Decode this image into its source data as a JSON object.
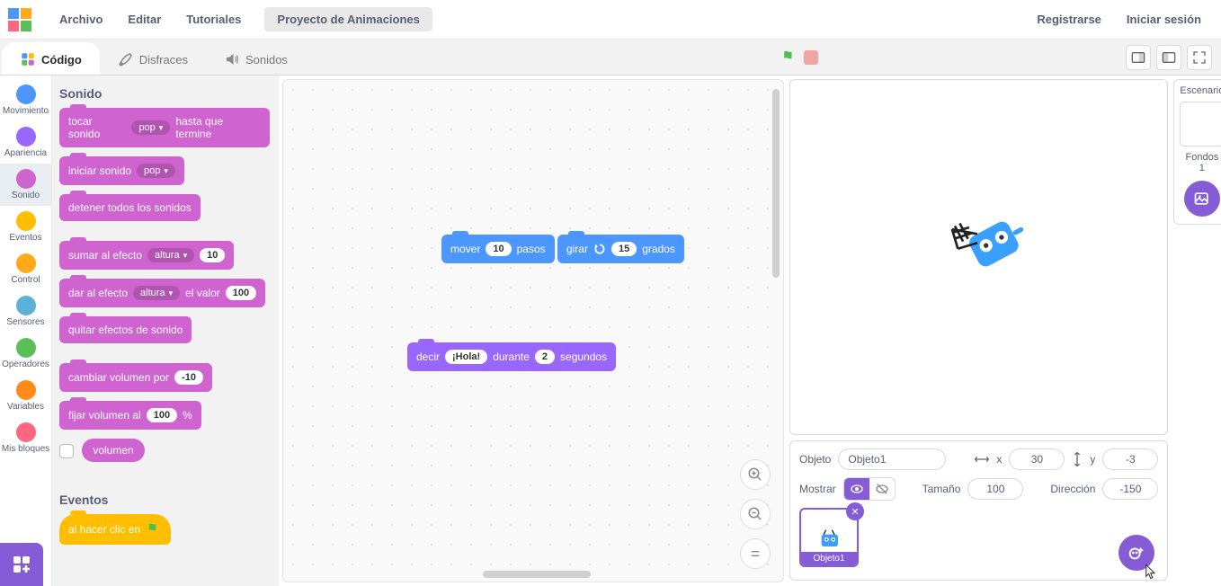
{
  "menubar": {
    "file": "Archivo",
    "edit": "Editar",
    "tutorials": "Tutoriales",
    "project_title": "Proyecto de Animaciones",
    "register": "Registrarse",
    "login": "Iniciar sesión"
  },
  "tabs": {
    "code": "Código",
    "costumes": "Disfraces",
    "sounds": "Sonidos"
  },
  "categories": [
    {
      "id": "motion",
      "label": "Movimiento",
      "color": "#4c97ff"
    },
    {
      "id": "looks",
      "label": "Apariencia",
      "color": "#9966ff"
    },
    {
      "id": "sound",
      "label": "Sonido",
      "color": "#cf63cf"
    },
    {
      "id": "events",
      "label": "Eventos",
      "color": "#ffbf00"
    },
    {
      "id": "control",
      "label": "Control",
      "color": "#ffab19"
    },
    {
      "id": "sensing",
      "label": "Sensores",
      "color": "#5cb1d6"
    },
    {
      "id": "operators",
      "label": "Operadores",
      "color": "#59c059"
    },
    {
      "id": "variables",
      "label": "Variables",
      "color": "#ff8c1a"
    },
    {
      "id": "myblocks",
      "label": "Mis bloques",
      "color": "#ff6680"
    }
  ],
  "palette": {
    "heading_sound": "Sonido",
    "heading_events": "Eventos",
    "play_until": {
      "pre": "tocar sonido",
      "dd": "pop",
      "post": "hasta que termine"
    },
    "start_sound": {
      "pre": "iniciar sonido",
      "dd": "pop"
    },
    "stop_all": "detener todos los sonidos",
    "change_effect": {
      "pre": "sumar al efecto",
      "dd": "altura",
      "val": "10"
    },
    "set_effect": {
      "pre": "dar al efecto",
      "dd": "altura",
      "mid": "el valor",
      "val": "100"
    },
    "clear_effects": "quitar efectos de sonido",
    "change_volume": {
      "pre": "cambiar volumen por",
      "val": "-10"
    },
    "set_volume": {
      "pre": "fijar volumen al",
      "val": "100",
      "post": "%"
    },
    "volume_reporter": "volumen",
    "when_flag": "al hacer clic en"
  },
  "workspace": {
    "move": {
      "pre": "mover",
      "val": "10",
      "post": "pasos"
    },
    "turn": {
      "pre": "girar",
      "val": "15",
      "post": "grados"
    },
    "say": {
      "pre": "decir",
      "txt": "¡Hola!",
      "mid": "durante",
      "val": "2",
      "post": "segundos"
    }
  },
  "sprite_panel": {
    "object_label": "Objeto",
    "object_name": "Objeto1",
    "x_label": "x",
    "x_val": "30",
    "y_label": "y",
    "y_val": "-3",
    "show_label": "Mostrar",
    "size_label": "Tamaño",
    "size_val": "100",
    "dir_label": "Dirección",
    "dir_val": "-150"
  },
  "stage_side": {
    "scenario": "Escenario",
    "backdrops": "Fondos",
    "count": "1"
  },
  "colors": {
    "sound": "#cf63cf",
    "motion": "#4c97ff",
    "looks": "#9966ff",
    "events": "#ffbf00"
  }
}
